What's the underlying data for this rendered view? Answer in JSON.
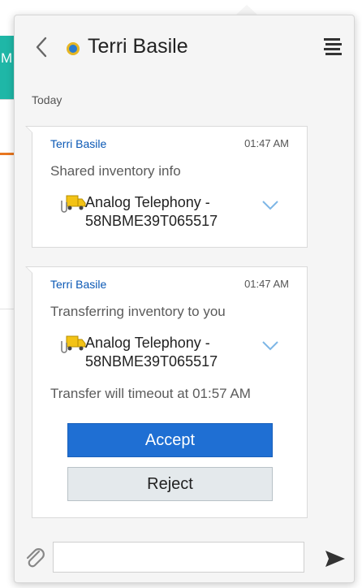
{
  "background_app": {
    "header_letter": "M"
  },
  "header": {
    "contact_name": "Terri Basile"
  },
  "day_label": "Today",
  "messages": [
    {
      "sender": "Terri Basile",
      "time": "01:47 AM",
      "text": "Shared inventory info",
      "asset": "Analog Telephony - 58NBME39T065517"
    },
    {
      "sender": "Terri Basile",
      "time": "01:47 AM",
      "text": "Transferring inventory to you",
      "asset": "Analog Telephony - 58NBME39T065517",
      "timeout_text": "Transfer will timeout at 01:57 AM",
      "accept_label": "Accept",
      "reject_label": "Reject"
    }
  ],
  "composer": {
    "value": "",
    "placeholder": ""
  },
  "colors": {
    "accent_blue": "#1f6fd3",
    "sender_blue": "#0a58b5",
    "teal": "#1fb7a7",
    "orange": "#e8761f"
  },
  "icons": [
    "back-chevron-icon",
    "status-dot-icon",
    "hamburger-menu-icon",
    "inventory-truck-icon",
    "chevron-down-icon",
    "paperclip-icon",
    "send-icon"
  ]
}
